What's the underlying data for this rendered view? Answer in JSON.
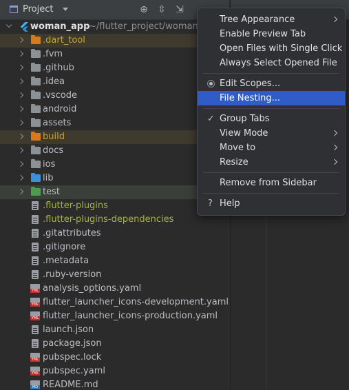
{
  "toolbar": {
    "title": "Project",
    "icons": [
      "project-view-icon",
      "locate-icon",
      "expand-all-icon",
      "collapse-all-icon",
      "options-gear-icon"
    ]
  },
  "tree": {
    "root": {
      "name": "woman_app",
      "path": "~/flutter_project/woman_"
    },
    "items": [
      {
        "label": ".dart_tool",
        "kind": "folder",
        "color": "#c8a53a",
        "icon_color": "#d47a1f",
        "bg": "excluded"
      },
      {
        "label": ".fvm",
        "kind": "folder",
        "color": "#bcbec4",
        "icon_color": "#8c9196"
      },
      {
        "label": ".github",
        "kind": "folder",
        "color": "#bcbec4",
        "icon_color": "#8c9196"
      },
      {
        "label": ".idea",
        "kind": "folder",
        "color": "#bcbec4",
        "icon_color": "#8c9196"
      },
      {
        "label": ".vscode",
        "kind": "folder",
        "color": "#bcbec4",
        "icon_color": "#8c9196"
      },
      {
        "label": "android",
        "kind": "folder",
        "color": "#bcbec4",
        "icon_color": "#8c9196"
      },
      {
        "label": "assets",
        "kind": "folder",
        "color": "#bcbec4",
        "icon_color": "#8c9196"
      },
      {
        "label": "build",
        "kind": "folder",
        "color": "#c8a53a",
        "icon_color": "#d47a1f",
        "bg": "excluded"
      },
      {
        "label": "docs",
        "kind": "folder",
        "color": "#bcbec4",
        "icon_color": "#8c9196"
      },
      {
        "label": "ios",
        "kind": "folder",
        "color": "#bcbec4",
        "icon_color": "#8c9196"
      },
      {
        "label": "lib",
        "kind": "folder",
        "color": "#bcbec4",
        "icon_color": "#3d8fd6"
      },
      {
        "label": "test",
        "kind": "folder",
        "color": "#bcbec4",
        "icon_color": "#4e9a4e",
        "bg": "testsrc"
      },
      {
        "label": ".flutter-plugins",
        "kind": "file",
        "color": "#a8b340"
      },
      {
        "label": ".flutter-plugins-dependencies",
        "kind": "file",
        "color": "#a8b340"
      },
      {
        "label": ".gitattributes",
        "kind": "file",
        "color": "#bcbec4"
      },
      {
        "label": ".gitignore",
        "kind": "file",
        "color": "#bcbec4"
      },
      {
        "label": ".metadata",
        "kind": "file",
        "color": "#bcbec4"
      },
      {
        "label": ".ruby-version",
        "kind": "file",
        "color": "#bcbec4"
      },
      {
        "label": "analysis_options.yaml",
        "kind": "yml",
        "color": "#bcbec4"
      },
      {
        "label": "flutter_launcher_icons-development.yaml",
        "kind": "yml",
        "color": "#bcbec4"
      },
      {
        "label": "flutter_launcher_icons-production.yaml",
        "kind": "yml",
        "color": "#bcbec4"
      },
      {
        "label": "launch.json",
        "kind": "file",
        "color": "#bcbec4"
      },
      {
        "label": "package.json",
        "kind": "file",
        "color": "#bcbec4"
      },
      {
        "label": "pubspec.lock",
        "kind": "yml",
        "color": "#bcbec4"
      },
      {
        "label": "pubspec.yaml",
        "kind": "yml",
        "color": "#bcbec4"
      },
      {
        "label": "README.md",
        "kind": "md",
        "color": "#bcbec4"
      }
    ]
  },
  "menu": {
    "groups": [
      [
        {
          "label": "Tree Appearance",
          "submenu": true
        },
        {
          "label": "Enable Preview Tab"
        },
        {
          "label": "Open Files with Single Click"
        },
        {
          "label": "Always Select Opened File"
        }
      ],
      [
        {
          "label": "Edit Scopes...",
          "icon": "radio"
        },
        {
          "label": "File Nesting...",
          "highlighted": true
        }
      ],
      [
        {
          "label": "Group Tabs",
          "icon": "check"
        },
        {
          "label": "View Mode",
          "submenu": true
        },
        {
          "label": "Move to",
          "submenu": true
        },
        {
          "label": "Resize",
          "submenu": true
        }
      ],
      [
        {
          "label": "Remove from Sidebar"
        }
      ],
      [
        {
          "label": "Help",
          "icon": "help"
        }
      ]
    ]
  }
}
